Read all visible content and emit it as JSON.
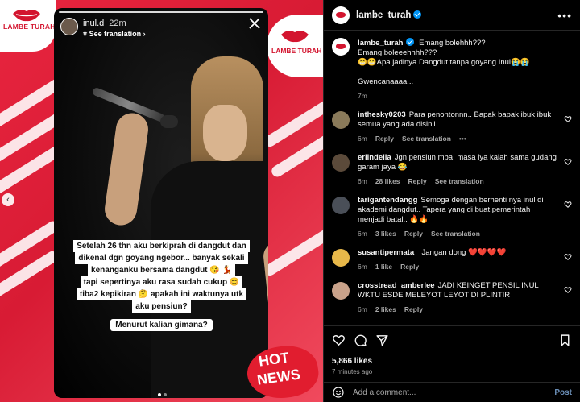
{
  "post_image": {
    "logo_text": "LAMBE TURAH",
    "story": {
      "username": "inul.d",
      "time": "22m",
      "see_translation": "See translation",
      "caption_lines": [
        "Setelah 26 thn aku berkiprah di dangdut dan",
        "dikenal dgn goyang ngebor...  banyak sekali",
        "kenanganku bersama dangdut 😘 💃",
        "tapi sepertinya aku rasa sudah cukup 😊",
        "tiba2 kepikiran 🤔 apakah ini waktunya utk",
        "aku pensiun?"
      ],
      "question": "Menurut kalian gimana?"
    },
    "hot_news": {
      "hot": "HOT",
      "news": "NEWS"
    }
  },
  "panel": {
    "header": {
      "username": "lambe_turah"
    },
    "caption": {
      "username": "lambe_turah",
      "text": "Emang bolehhh???\nEmang boleeehhhh???\n😁😁Apa jadinya Dangdut tanpa goyang Inul😭😭\n\nGwencanaaaa...",
      "time": "7m"
    },
    "comments": [
      {
        "username": "inthesky0203",
        "text": "Para penontonnn.. Bapak bapak ibuk ibuk semua yang ada disinii...",
        "time": "6m",
        "likes": "",
        "reply": "Reply",
        "translate": "See translation",
        "more": "•••",
        "avatar_color": "#8a7a5a"
      },
      {
        "username": "erlindella",
        "text": "Jgn pensiun mba, masa iya kalah sama gudang garam jaya 😂",
        "time": "6m",
        "likes": "28 likes",
        "reply": "Reply",
        "translate": "See translation",
        "more": "",
        "avatar_color": "#5b4a3a"
      },
      {
        "username": "tarigantendangg",
        "text": "Semoga dengan berhenti nya inul di akademi dangdut.. Tapera yang di buat pemerintah menjadi batal.. 🔥🔥",
        "time": "6m",
        "likes": "3 likes",
        "reply": "Reply",
        "translate": "See translation",
        "more": "",
        "avatar_color": "#4a4f58"
      },
      {
        "username": "susantipermata_",
        "text": "Jangan dong ❤️❤️❤️❤️",
        "time": "6m",
        "likes": "1 like",
        "reply": "Reply",
        "translate": "",
        "more": "",
        "avatar_color": "#e8b84a"
      },
      {
        "username": "crosstread_amberlee",
        "text": "JADI KEINGET PENSIL INUL WKTU ESDE MELEYOT LEYOT DI PLINTIR",
        "time": "6m",
        "likes": "2 likes",
        "reply": "Reply",
        "translate": "",
        "more": "",
        "avatar_color": "#c9a28a"
      }
    ],
    "likes": "5,866 likes",
    "ago": "7 minutes ago",
    "add_comment_placeholder": "Add a comment...",
    "post_label": "Post"
  },
  "colors": {
    "brand_red": "#e8253f",
    "verified_blue": "#0095f6"
  }
}
